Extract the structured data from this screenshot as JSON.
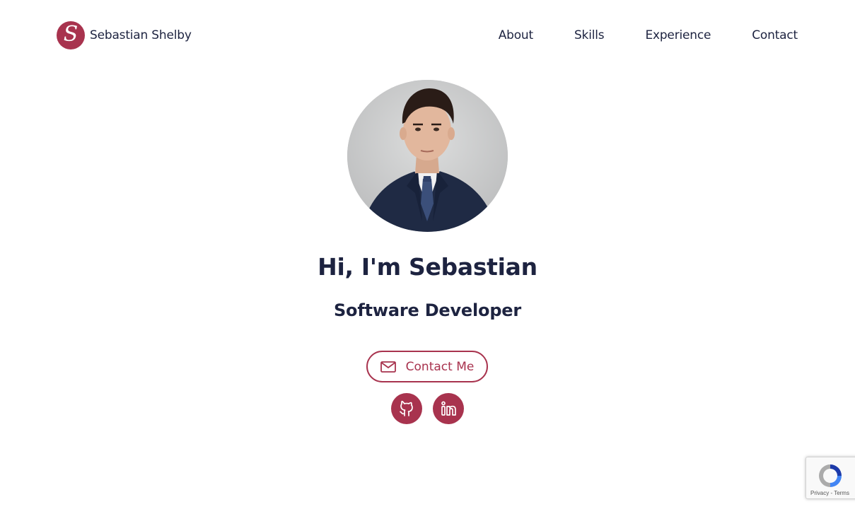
{
  "brand": {
    "logo_letter": "S",
    "name": "Sebastian Shelby",
    "accent_color": "#a8334e"
  },
  "nav": {
    "items": [
      {
        "label": "About"
      },
      {
        "label": "Skills"
      },
      {
        "label": "Experience"
      },
      {
        "label": "Contact"
      }
    ]
  },
  "hero": {
    "avatar_icon": "profile-photo",
    "title": "Hi, I'm Sebastian",
    "subtitle": "Software Developer",
    "contact_button": {
      "label": "Contact Me",
      "icon": "mail-icon"
    },
    "social": [
      {
        "name": "github",
        "icon": "github-icon"
      },
      {
        "name": "linkedin",
        "icon": "linkedin-icon"
      }
    ]
  },
  "recaptcha": {
    "links": "Privacy - Terms"
  },
  "colors": {
    "text": "#1d2340",
    "accent": "#a8334e",
    "background": "#ffffff"
  }
}
